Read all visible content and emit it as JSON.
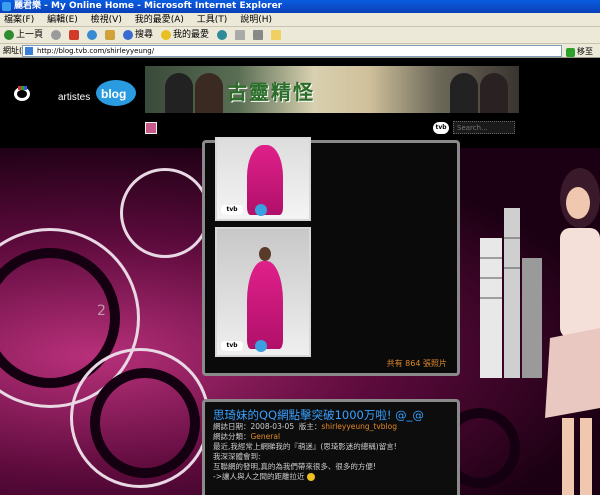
{
  "window": {
    "title": "麗君樂 - My Online Home - Microsoft Internet Explorer"
  },
  "menu": [
    "檔案(F)",
    "編輯(E)",
    "檢視(V)",
    "我的最愛(A)",
    "工具(T)",
    "說明(H)"
  ],
  "toolbar": {
    "back": "上一頁",
    "search": "搜尋",
    "favorites": "我的最愛"
  },
  "address": {
    "label": "網址(D)",
    "url": "http://blog.tvb.com/shirleyyeung/",
    "go": "移至"
  },
  "site": {
    "logo_tvb": "tvb",
    "logo_artistes": "artistes",
    "logo_blog": "blog",
    "search_placeholder": "Search...",
    "tvb_badge": "tvb"
  },
  "banner": {
    "title": "古靈精怪"
  },
  "gallery": {
    "total_label": "共有 864 張照片",
    "page_number": "2",
    "watermark": "tvb"
  },
  "post": {
    "title": "思琦妹的QQ網點擊突破1000万啦! @_@",
    "date_label": "網誌日期：",
    "date": "2008-03-05",
    "owner_label": "版主：",
    "owner": "shirleyyeung_tvblog",
    "category_label": "網誌分類：",
    "category": "General",
    "lines": [
      "最近,我經常上網睇我的『萌迷』(思琦影迷的總稱)留言!",
      "我深深體會到:",
      "互聯網的發明,真的為我們帶來很多、很多的方便!",
      "->讓人與人之間的距離拉近"
    ]
  },
  "colors": {
    "post_title": "#3aa0ff",
    "accent_orange": "#e08a2a",
    "bg_pink": "#b8307a"
  }
}
